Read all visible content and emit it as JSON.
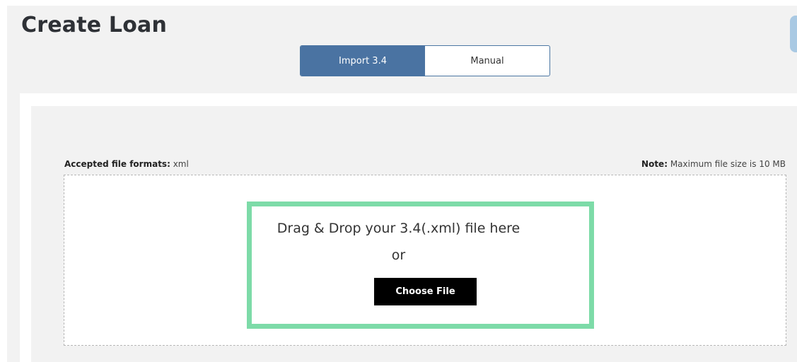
{
  "page": {
    "title": "Create Loan"
  },
  "tabs": [
    {
      "label": "Import 3.4",
      "active": true
    },
    {
      "label": "Manual",
      "active": false
    }
  ],
  "upload": {
    "formats_label": "Accepted file formats:",
    "formats_value": " xml",
    "note_label": "Note:",
    "note_value": " Maximum file size is 10 MB",
    "drop_text": "Drag & Drop your 3.4(.xml) file here",
    "or_text": "or",
    "choose_button": "Choose File"
  },
  "colors": {
    "accent": "#4a73a2",
    "highlight": "#7ddba8",
    "button": "#000000"
  }
}
